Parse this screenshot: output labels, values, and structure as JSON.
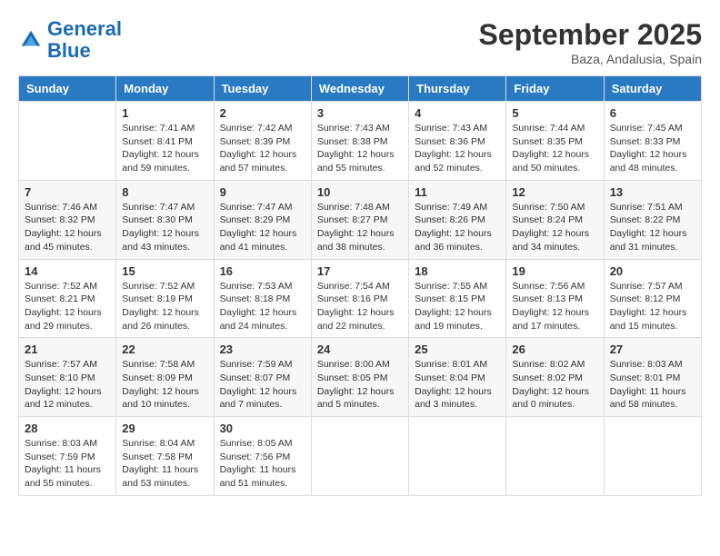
{
  "header": {
    "logo_general": "General",
    "logo_blue": "Blue",
    "month_title": "September 2025",
    "location": "Baza, Andalusia, Spain"
  },
  "columns": [
    "Sunday",
    "Monday",
    "Tuesday",
    "Wednesday",
    "Thursday",
    "Friday",
    "Saturday"
  ],
  "weeks": [
    [
      {
        "day": "",
        "sunrise": "",
        "sunset": "",
        "daylight": ""
      },
      {
        "day": "1",
        "sunrise": "Sunrise: 7:41 AM",
        "sunset": "Sunset: 8:41 PM",
        "daylight": "Daylight: 12 hours and 59 minutes."
      },
      {
        "day": "2",
        "sunrise": "Sunrise: 7:42 AM",
        "sunset": "Sunset: 8:39 PM",
        "daylight": "Daylight: 12 hours and 57 minutes."
      },
      {
        "day": "3",
        "sunrise": "Sunrise: 7:43 AM",
        "sunset": "Sunset: 8:38 PM",
        "daylight": "Daylight: 12 hours and 55 minutes."
      },
      {
        "day": "4",
        "sunrise": "Sunrise: 7:43 AM",
        "sunset": "Sunset: 8:36 PM",
        "daylight": "Daylight: 12 hours and 52 minutes."
      },
      {
        "day": "5",
        "sunrise": "Sunrise: 7:44 AM",
        "sunset": "Sunset: 8:35 PM",
        "daylight": "Daylight: 12 hours and 50 minutes."
      },
      {
        "day": "6",
        "sunrise": "Sunrise: 7:45 AM",
        "sunset": "Sunset: 8:33 PM",
        "daylight": "Daylight: 12 hours and 48 minutes."
      }
    ],
    [
      {
        "day": "7",
        "sunrise": "Sunrise: 7:46 AM",
        "sunset": "Sunset: 8:32 PM",
        "daylight": "Daylight: 12 hours and 45 minutes."
      },
      {
        "day": "8",
        "sunrise": "Sunrise: 7:47 AM",
        "sunset": "Sunset: 8:30 PM",
        "daylight": "Daylight: 12 hours and 43 minutes."
      },
      {
        "day": "9",
        "sunrise": "Sunrise: 7:47 AM",
        "sunset": "Sunset: 8:29 PM",
        "daylight": "Daylight: 12 hours and 41 minutes."
      },
      {
        "day": "10",
        "sunrise": "Sunrise: 7:48 AM",
        "sunset": "Sunset: 8:27 PM",
        "daylight": "Daylight: 12 hours and 38 minutes."
      },
      {
        "day": "11",
        "sunrise": "Sunrise: 7:49 AM",
        "sunset": "Sunset: 8:26 PM",
        "daylight": "Daylight: 12 hours and 36 minutes."
      },
      {
        "day": "12",
        "sunrise": "Sunrise: 7:50 AM",
        "sunset": "Sunset: 8:24 PM",
        "daylight": "Daylight: 12 hours and 34 minutes."
      },
      {
        "day": "13",
        "sunrise": "Sunrise: 7:51 AM",
        "sunset": "Sunset: 8:22 PM",
        "daylight": "Daylight: 12 hours and 31 minutes."
      }
    ],
    [
      {
        "day": "14",
        "sunrise": "Sunrise: 7:52 AM",
        "sunset": "Sunset: 8:21 PM",
        "daylight": "Daylight: 12 hours and 29 minutes."
      },
      {
        "day": "15",
        "sunrise": "Sunrise: 7:52 AM",
        "sunset": "Sunset: 8:19 PM",
        "daylight": "Daylight: 12 hours and 26 minutes."
      },
      {
        "day": "16",
        "sunrise": "Sunrise: 7:53 AM",
        "sunset": "Sunset: 8:18 PM",
        "daylight": "Daylight: 12 hours and 24 minutes."
      },
      {
        "day": "17",
        "sunrise": "Sunrise: 7:54 AM",
        "sunset": "Sunset: 8:16 PM",
        "daylight": "Daylight: 12 hours and 22 minutes."
      },
      {
        "day": "18",
        "sunrise": "Sunrise: 7:55 AM",
        "sunset": "Sunset: 8:15 PM",
        "daylight": "Daylight: 12 hours and 19 minutes."
      },
      {
        "day": "19",
        "sunrise": "Sunrise: 7:56 AM",
        "sunset": "Sunset: 8:13 PM",
        "daylight": "Daylight: 12 hours and 17 minutes."
      },
      {
        "day": "20",
        "sunrise": "Sunrise: 7:57 AM",
        "sunset": "Sunset: 8:12 PM",
        "daylight": "Daylight: 12 hours and 15 minutes."
      }
    ],
    [
      {
        "day": "21",
        "sunrise": "Sunrise: 7:57 AM",
        "sunset": "Sunset: 8:10 PM",
        "daylight": "Daylight: 12 hours and 12 minutes."
      },
      {
        "day": "22",
        "sunrise": "Sunrise: 7:58 AM",
        "sunset": "Sunset: 8:09 PM",
        "daylight": "Daylight: 12 hours and 10 minutes."
      },
      {
        "day": "23",
        "sunrise": "Sunrise: 7:59 AM",
        "sunset": "Sunset: 8:07 PM",
        "daylight": "Daylight: 12 hours and 7 minutes."
      },
      {
        "day": "24",
        "sunrise": "Sunrise: 8:00 AM",
        "sunset": "Sunset: 8:05 PM",
        "daylight": "Daylight: 12 hours and 5 minutes."
      },
      {
        "day": "25",
        "sunrise": "Sunrise: 8:01 AM",
        "sunset": "Sunset: 8:04 PM",
        "daylight": "Daylight: 12 hours and 3 minutes."
      },
      {
        "day": "26",
        "sunrise": "Sunrise: 8:02 AM",
        "sunset": "Sunset: 8:02 PM",
        "daylight": "Daylight: 12 hours and 0 minutes."
      },
      {
        "day": "27",
        "sunrise": "Sunrise: 8:03 AM",
        "sunset": "Sunset: 8:01 PM",
        "daylight": "Daylight: 11 hours and 58 minutes."
      }
    ],
    [
      {
        "day": "28",
        "sunrise": "Sunrise: 8:03 AM",
        "sunset": "Sunset: 7:59 PM",
        "daylight": "Daylight: 11 hours and 55 minutes."
      },
      {
        "day": "29",
        "sunrise": "Sunrise: 8:04 AM",
        "sunset": "Sunset: 7:58 PM",
        "daylight": "Daylight: 11 hours and 53 minutes."
      },
      {
        "day": "30",
        "sunrise": "Sunrise: 8:05 AM",
        "sunset": "Sunset: 7:56 PM",
        "daylight": "Daylight: 11 hours and 51 minutes."
      },
      {
        "day": "",
        "sunrise": "",
        "sunset": "",
        "daylight": ""
      },
      {
        "day": "",
        "sunrise": "",
        "sunset": "",
        "daylight": ""
      },
      {
        "day": "",
        "sunrise": "",
        "sunset": "",
        "daylight": ""
      },
      {
        "day": "",
        "sunrise": "",
        "sunset": "",
        "daylight": ""
      }
    ]
  ]
}
